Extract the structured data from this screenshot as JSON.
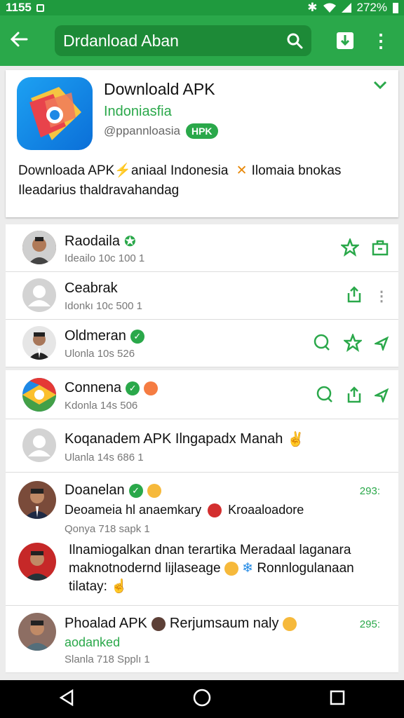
{
  "status": {
    "time": "1155",
    "battery": "272%"
  },
  "appbar": {
    "search_text": "Drdanload Aban"
  },
  "app": {
    "title": "Downloald APK",
    "subtitle": "Indoniasfia",
    "developer": "@ppannloasia",
    "badge": "HPK",
    "description_line1": "Downloada APK",
    "description_mid": "aniaal Indonesia",
    "description_end": "Ilomaia bnokas",
    "description_line2": "Ileadarius thaldravahandag"
  },
  "users": [
    {
      "name": "Raodaila",
      "meta": "Ideailo 10c 100   1"
    },
    {
      "name": "Ceabrak",
      "meta": "Idonkı 10c 500   1"
    },
    {
      "name": "Oldmeran",
      "meta": "Ulonla 10s 526"
    },
    {
      "name": "Connena",
      "meta": "Kdonla 14s 506"
    },
    {
      "name": "Koqanadem APK Ilngapadx Manah",
      "meta": "Ulanla 14s 686   1"
    }
  ],
  "comments": [
    {
      "name": "Doanelan",
      "count": "293:",
      "line": "Deoameia hl anaemkary",
      "line_end": "Kroaaloadore",
      "meta": "Qonya 718 sapk   1",
      "body1": "Ilnamiogalkan dnan terartika Meradaal laganara",
      "body2": "maknotnodernd lijlaseage",
      "body2_end": "Ronnlogulanaan",
      "body3": "tilatay:"
    },
    {
      "name": "Phoalad APK",
      "name_end": "Rerjumsaum naly",
      "count": "295:",
      "tag": "aodanked",
      "meta": "Slanla 718 Spplı   1"
    }
  ],
  "colors": {
    "primary": "#2aa84a",
    "status": "#1f9a3e",
    "search": "#1d8a37"
  }
}
